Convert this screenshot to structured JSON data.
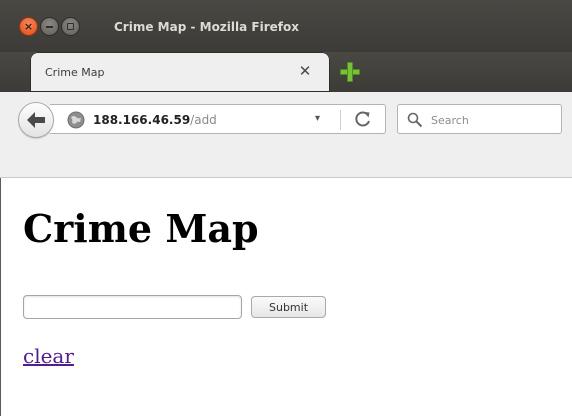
{
  "window": {
    "title": "Crime Map - Mozilla Firefox",
    "controls": {
      "close": "×",
      "minimize": "",
      "maximize": ""
    }
  },
  "tabs": [
    {
      "label": "Crime Map",
      "close_glyph": "✕",
      "active": true
    }
  ],
  "newtab": {
    "icon": "plus-icon"
  },
  "navbar": {
    "back_icon": "back-arrow-icon",
    "url": {
      "host": "188.166.46.59",
      "path": "/add"
    },
    "dropmarker": "▾",
    "reload_icon": "reload-icon",
    "search": {
      "placeholder": "Search",
      "icon": "magnifier-icon"
    }
  },
  "page": {
    "title": "Crime Map",
    "input": {
      "value": "",
      "placeholder": ""
    },
    "submit_label": "Submit",
    "clear_link": "clear"
  },
  "colors": {
    "titlebar": "#3c3b37",
    "close_button": "#df4a16",
    "newtab_plus": "#78c23a",
    "visited_link": "#551a8b"
  }
}
